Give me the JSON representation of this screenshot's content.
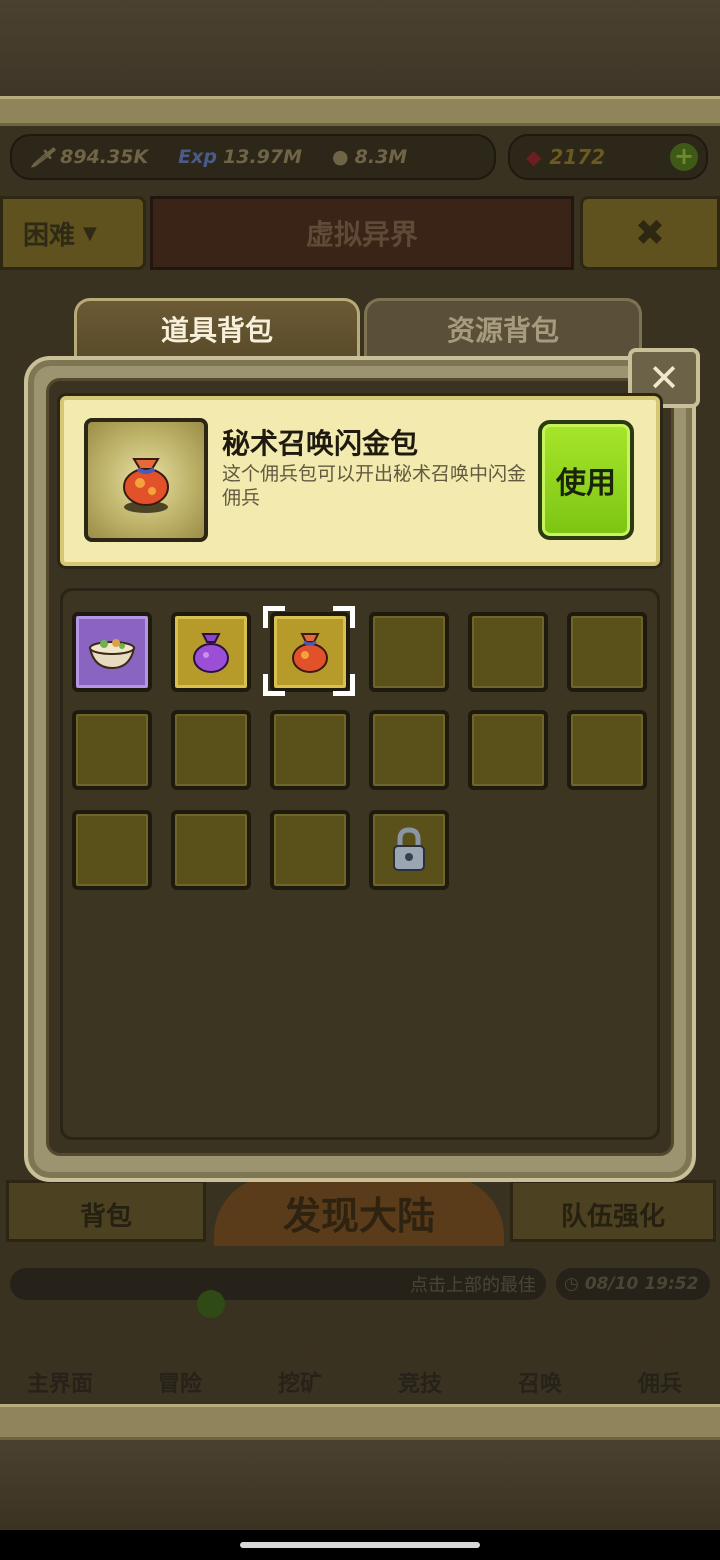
{
  "resources": {
    "attack": "894.35K",
    "exp_label": "Exp",
    "exp": "13.97M",
    "gold": "8.3M",
    "gems": "2172",
    "add_symbol": "+"
  },
  "header": {
    "difficulty": "困难",
    "area_title": "虚拟异界"
  },
  "bag": {
    "tabs": [
      "道具背包",
      "资源背包"
    ],
    "close_symbol": "✕",
    "selected_item": {
      "name": "秘术召唤闪金包",
      "description": "这个佣兵包可以开出秘术召唤中闪金佣兵",
      "use_label": "使用"
    },
    "slots": [
      {
        "type": "purple",
        "icon": "food-bowl-icon"
      },
      {
        "type": "gold",
        "icon": "purple-bag-icon"
      },
      {
        "type": "gold",
        "icon": "red-bag-icon",
        "selected": true
      },
      {
        "type": "empty"
      },
      {
        "type": "empty"
      },
      {
        "type": "empty"
      },
      {
        "type": "empty"
      },
      {
        "type": "empty"
      },
      {
        "type": "empty"
      },
      {
        "type": "empty"
      },
      {
        "type": "empty"
      },
      {
        "type": "empty"
      },
      {
        "type": "empty"
      },
      {
        "type": "empty"
      },
      {
        "type": "empty"
      },
      {
        "type": "locked",
        "icon": "lock-icon"
      }
    ]
  },
  "footer": {
    "bag_tab": "背包",
    "discover": "发现大陆",
    "team_tab": "队伍强化",
    "hint": "点击上部的最佳",
    "time": "08/10 19:52",
    "nav": [
      "主界面",
      "冒险",
      "挖矿",
      "竞技",
      "召唤",
      "佣兵"
    ]
  },
  "colors": {
    "use_button": "#9ad925",
    "panel": "#9c9470",
    "detail_bg": "#f3eab0"
  }
}
